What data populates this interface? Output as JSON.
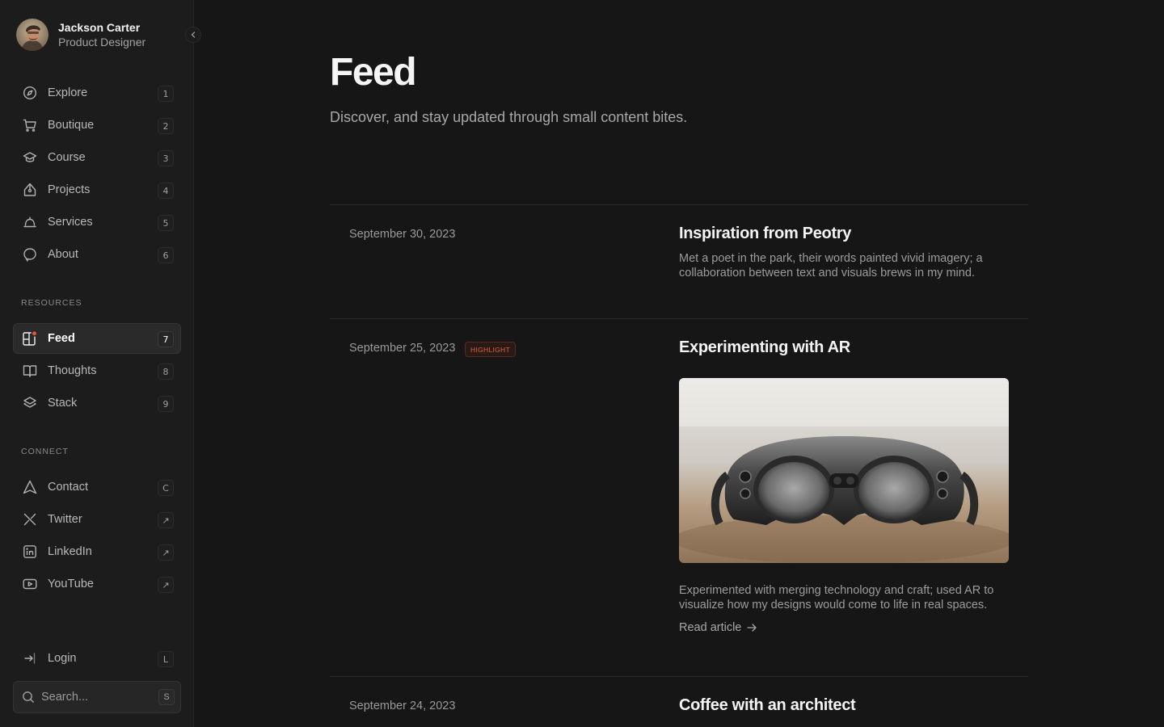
{
  "profile": {
    "name": "Jackson Carter",
    "role": "Product Designer"
  },
  "nav": [
    {
      "label": "Explore",
      "key": "1",
      "icon": "compass-icon"
    },
    {
      "label": "Boutique",
      "key": "2",
      "icon": "cart-icon"
    },
    {
      "label": "Course",
      "key": "3",
      "icon": "graduation-cap-icon"
    },
    {
      "label": "Projects",
      "key": "4",
      "icon": "pen-nib-icon"
    },
    {
      "label": "Services",
      "key": "5",
      "icon": "service-bell-icon"
    },
    {
      "label": "About",
      "key": "6",
      "icon": "chat-bubble-icon"
    }
  ],
  "resources_label": "RESOURCES",
  "resources": [
    {
      "label": "Feed",
      "key": "7",
      "icon": "feed-icon",
      "active": true
    },
    {
      "label": "Thoughts",
      "key": "8",
      "icon": "book-icon"
    },
    {
      "label": "Stack",
      "key": "9",
      "icon": "layers-icon"
    }
  ],
  "connect_label": "CONNECT",
  "connect": [
    {
      "label": "Contact",
      "key": "C",
      "icon": "send-icon"
    },
    {
      "label": "Twitter",
      "key": "↗",
      "icon": "x-twitter-icon"
    },
    {
      "label": "LinkedIn",
      "key": "↗",
      "icon": "linkedin-icon"
    },
    {
      "label": "YouTube",
      "key": "↗",
      "icon": "youtube-icon"
    }
  ],
  "login": {
    "label": "Login",
    "key": "L"
  },
  "search": {
    "placeholder": "Search...",
    "key": "S"
  },
  "page": {
    "title": "Feed",
    "subtitle": "Discover, and stay updated through small content bites."
  },
  "posts": [
    {
      "date": "September 30, 2023",
      "title": "Inspiration from Peotry",
      "body": "Met a poet in the park, their words painted vivid imagery; a collaboration between text and visuals brews in my mind."
    },
    {
      "date": "September 25, 2023",
      "badge": "HIGHLIGHT",
      "title": "Experimenting with AR",
      "body": "Experimented with merging technology and craft; used AR to visualize how my designs would come to life in real spaces.",
      "link": "Read article"
    },
    {
      "date": "September 24, 2023",
      "title": "Coffee with an architect"
    }
  ],
  "colors": {
    "background": "#161616",
    "sidebar": "#1c1c1c",
    "accent": "#e0643e",
    "active_dot": "#e5533d"
  }
}
